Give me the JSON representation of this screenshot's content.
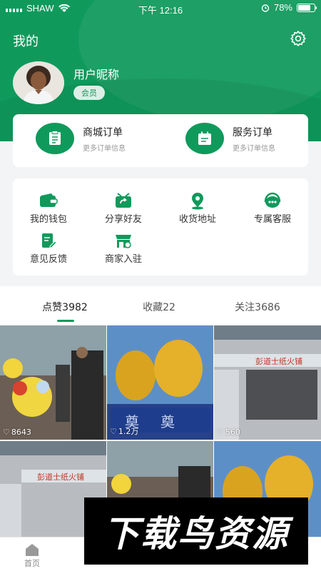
{
  "status_bar": {
    "carrier": "SHAW",
    "time": "下午 12:16",
    "battery": "78%",
    "battery_level": 0.78
  },
  "header": {
    "title": "我的"
  },
  "profile": {
    "nickname": "用户昵称",
    "badge": "会员"
  },
  "orders": [
    {
      "title": "商城订单",
      "subtitle": "更多订单信息",
      "icon": "clipboard-icon"
    },
    {
      "title": "服务订单",
      "subtitle": "更多订单信息",
      "icon": "calendar-icon"
    }
  ],
  "tools": [
    {
      "label": "我的钱包",
      "icon": "wallet-icon"
    },
    {
      "label": "分享好友",
      "icon": "share-icon"
    },
    {
      "label": "收货地址",
      "icon": "location-icon"
    },
    {
      "label": "专属客服",
      "icon": "headset-icon"
    },
    {
      "label": "意见反馈",
      "icon": "feedback-icon"
    },
    {
      "label": "商家入驻",
      "icon": "store-icon"
    }
  ],
  "tabs": [
    {
      "label": "点赞3982",
      "active": true
    },
    {
      "label": "收藏22",
      "active": false
    },
    {
      "label": "关注3686",
      "active": false
    }
  ],
  "photos": [
    {
      "likes": "8643"
    },
    {
      "likes": "1.2万",
      "sign_text": "奠"
    },
    {
      "likes": "560",
      "sign_text": "彭道士纸火铺"
    },
    {
      "sign_text": "彭道士纸火铺"
    },
    {},
    {}
  ],
  "bottom_nav": [
    {
      "label": "首页",
      "icon": "home-icon",
      "active": false
    }
  ],
  "watermark": "下载鸟资源",
  "colors": {
    "accent": "#0f9a5c"
  }
}
